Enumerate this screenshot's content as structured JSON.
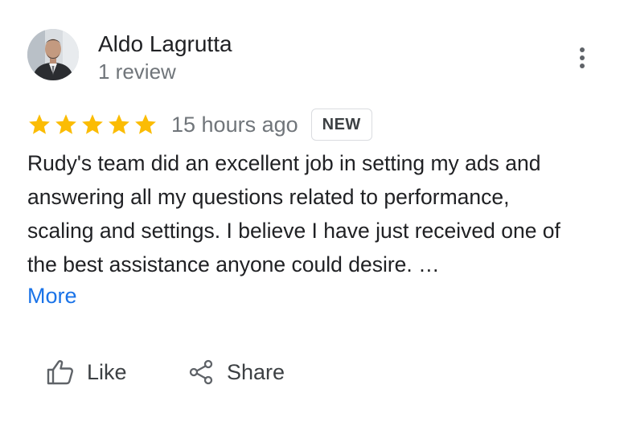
{
  "author": {
    "name": "Aldo Lagrutta",
    "review_count": "1 review",
    "avatar_icon": "profile-photo"
  },
  "review": {
    "rating": 5,
    "rating_max": 5,
    "star_color": "#fbbc04",
    "time": "15 hours ago",
    "badge": "NEW",
    "text_lines": [
      "Rudy's team did an excellent job in setting my ads and",
      "answering all my questions related to performance,",
      "scaling and settings. I believe I have just received one of",
      "the best assistance anyone could desire. …"
    ],
    "more_label": "More"
  },
  "actions": {
    "like_label": "Like",
    "share_label": "Share",
    "like_icon": "thumbs-up-icon",
    "share_icon": "share-icon",
    "menu_icon": "more-vert-icon"
  },
  "colors": {
    "link": "#1a73e8",
    "secondary_text": "#70757a"
  }
}
